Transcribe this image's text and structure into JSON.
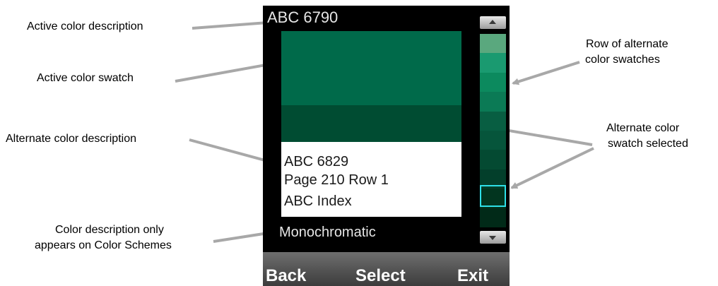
{
  "callouts": {
    "active_desc": "Active color description",
    "active_swatch": "Active color swatch",
    "alt_desc": "Alternate color description",
    "scheme_line1": "Color description only",
    "scheme_line2": "appears on Color Schemes",
    "row_line1": "Row of alternate",
    "row_line2": "color swatches",
    "selected_line1": "Alternate color",
    "selected_line2": "swatch selected"
  },
  "device": {
    "active_color_name": "ABC 6790",
    "alternate": {
      "line1": "ABC 6829",
      "line2": "Page 210 Row 1",
      "line3": "ABC Index"
    },
    "scheme_description": "Monochromatic",
    "softkeys": {
      "back": "Back",
      "select": "Select",
      "exit": "Exit"
    },
    "colors": {
      "active_swatch": "#006a4a",
      "alternate_swatch": "#004c32",
      "selection_outline": "#2ee0e8",
      "swatch_strip": [
        "#5aa87e",
        "#1a9a70",
        "#0c8a5e",
        "#0b7a55",
        "#085e42",
        "#06553b",
        "#044a32",
        "#033f2b",
        "#02351f",
        "#012a18"
      ]
    },
    "selected_swatch_index": 7
  }
}
